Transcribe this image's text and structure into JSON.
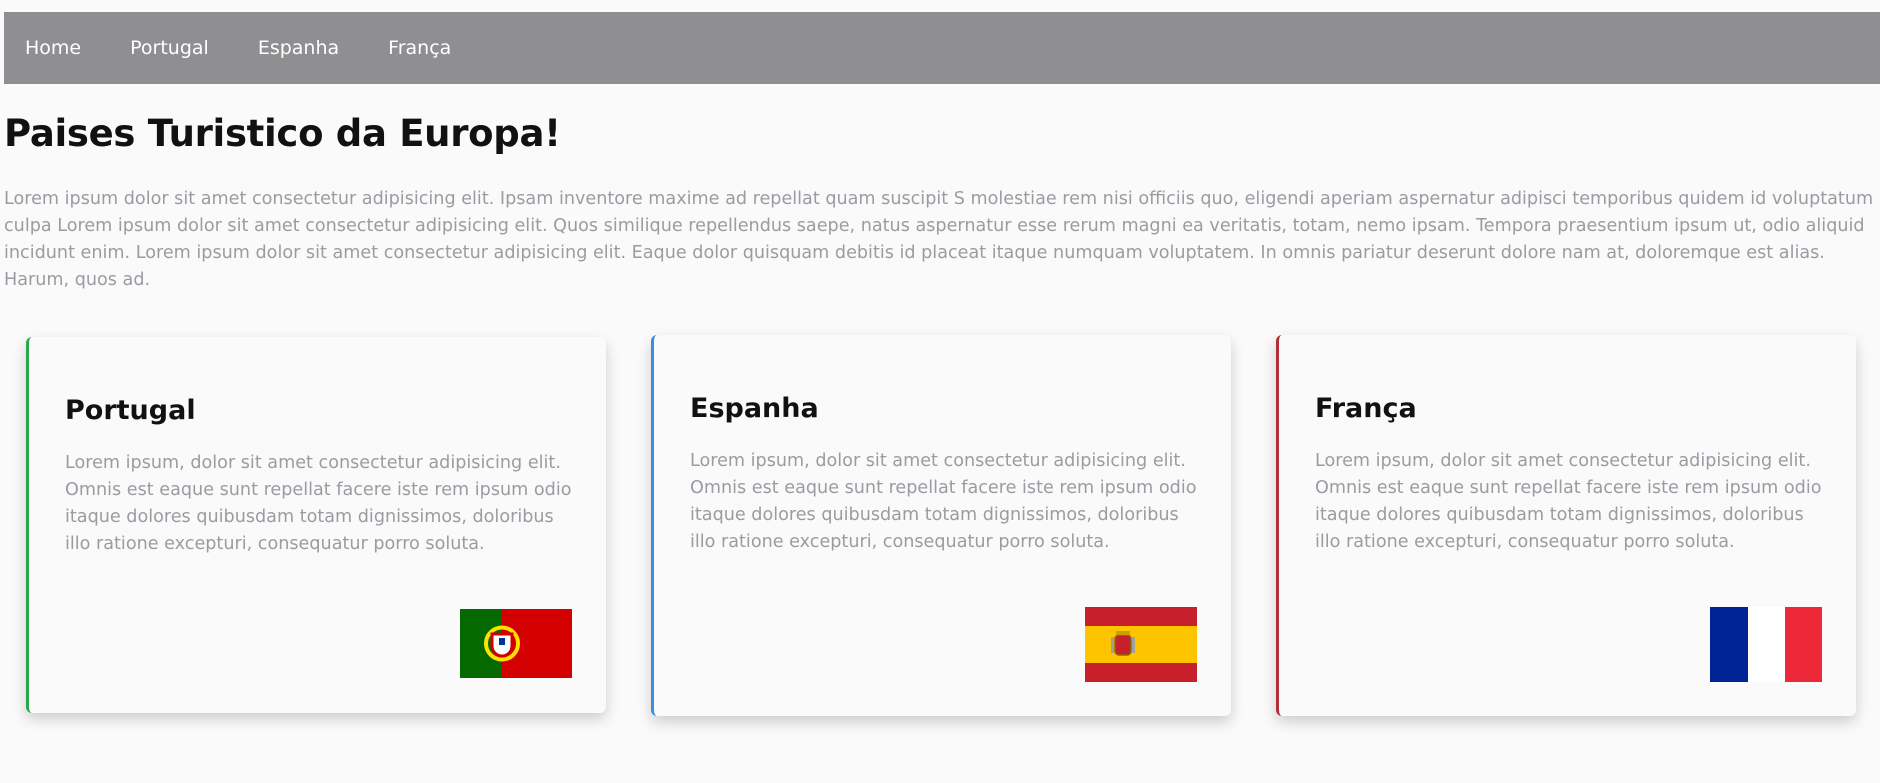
{
  "nav": {
    "items": [
      "Home",
      "Portugal",
      "Espanha",
      "França"
    ]
  },
  "main": {
    "title": "Paises Turistico da Europa!",
    "intro": "Lorem ipsum dolor sit amet consectetur adipisicing elit. Ipsam inventore maxime ad repellat quam suscipit S molestiae rem nisi officiis quo, eligendi aperiam aspernatur adipisci temporibus quidem id voluptatum culpa Lorem ipsum dolor sit amet consectetur adipisicing elit. Quos similique repellendus saepe, natus aspernatur esse rerum magni ea veritatis, totam, nemo ipsam. Tempora praesentium ipsum ut, odio aliquid incidunt enim. Lorem ipsum dolor sit amet consectetur adipisicing elit. Eaque dolor quisquam debitis id placeat itaque numquam voluptatem. In omnis pariatur deserunt dolore nam at, doloremque est alias. Harum, quos ad."
  },
  "cards": [
    {
      "title": "Portugal",
      "text": "Lorem ipsum, dolor sit amet consectetur adipisicing elit. Omnis est eaque sunt repellat facere iste rem ipsum odio itaque dolores quibusdam totam dignissimos, doloribus illo ratione excepturi, consequatur porro soluta.",
      "accent": "#2aa84a",
      "flag_icon": "portugal-flag-icon"
    },
    {
      "title": "Espanha",
      "text": "Lorem ipsum, dolor sit amet consectetur adipisicing elit. Omnis est eaque sunt repellat facere iste rem ipsum odio itaque dolores quibusdam totam dignissimos, doloribus illo ratione excepturi, consequatur porro soluta.",
      "accent": "#3b8de0",
      "flag_icon": "spain-flag-icon"
    },
    {
      "title": "França",
      "text": "Lorem ipsum, dolor sit amet consectetur adipisicing elit. Omnis est eaque sunt repellat facere iste rem ipsum odio itaque dolores quibusdam totam dignissimos, doloribus illo ratione excepturi, consequatur porro soluta.",
      "accent": "#b3303a",
      "flag_icon": "france-flag-icon"
    }
  ],
  "colors": {
    "navbar": "#8f8f91",
    "background": "#fafafa",
    "text_muted": "#9b9ba2"
  }
}
